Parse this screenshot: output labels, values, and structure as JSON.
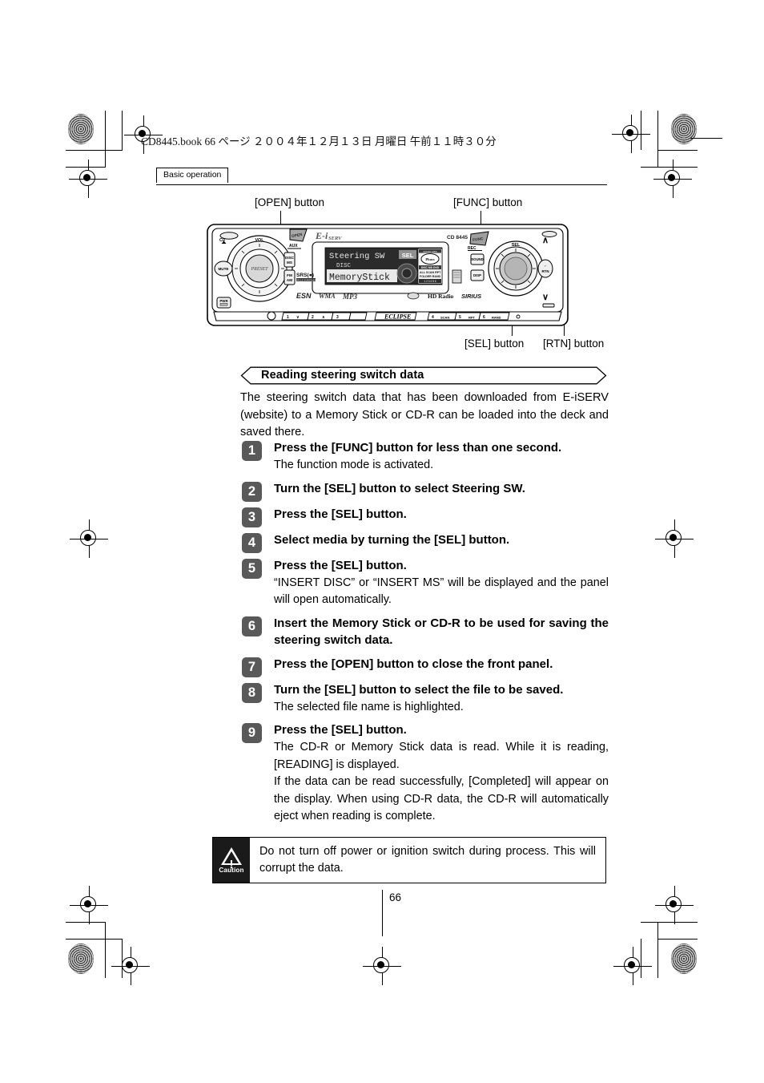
{
  "print_header": {
    "filename_line": "CD8445.book   66 ページ   ２００４年１２月１３日   月曜日   午前１１時３０分"
  },
  "section_tab": {
    "label": "Basic operation"
  },
  "device": {
    "model_label": "CD 8445",
    "brand_main": "E-iSERV",
    "brand_bottom": "ECLIPSE",
    "logo_strip": "ESN WMA MP3",
    "srs_label": "SRS(●)",
    "badges": [
      "HD Radio",
      "SIRIUS"
    ],
    "left_controls": {
      "cd_eject": "CD",
      "aux": "AUX",
      "disc_ms": "DISC MS",
      "fm_am": "FM AM",
      "mute": "MUTE",
      "pwr": "PWR",
      "vol": "VOL",
      "ring": "PRESET"
    },
    "right_controls": {
      "func": "FUNC",
      "rec": "REC",
      "sound": "SOUND",
      "disp": "DISP",
      "sel": "SEL",
      "rtn": "RTN",
      "up": "∧",
      "down": "∨"
    },
    "preset_buttons": [
      "1",
      "2",
      "3",
      "4",
      "5",
      "6"
    ],
    "preset_sublabels": [
      "∨",
      "∧",
      "",
      "SCAN",
      "RPT",
      "RAND"
    ],
    "display": {
      "line1": "Steering SW",
      "line2": "DISC",
      "line3": "MemoryStick",
      "sel_tag": "SEL",
      "indicator_rows": [
        "DISC  MS  DVD",
        "ALL SCAN RPT",
        "FOLDER RAND"
      ]
    }
  },
  "callouts": {
    "open": "[OPEN] button",
    "func": "[FUNC] button",
    "sel": "[SEL] button",
    "rtn": "[RTN] button"
  },
  "section": {
    "heading": "Reading steering switch data",
    "intro": "The steering switch data that has been downloaded from E-iSERV (website) to a Memory Stick or CD-R can be loaded into the deck and saved there."
  },
  "steps": [
    {
      "num": "1",
      "title": "Press the [FUNC] button for less than one second.",
      "note": "The function mode is activated."
    },
    {
      "num": "2",
      "title": "Turn the [SEL] button to select Steering SW.",
      "note": ""
    },
    {
      "num": "3",
      "title": "Press the [SEL] button.",
      "note": ""
    },
    {
      "num": "4",
      "title": "Select media by turning the [SEL] button.",
      "note": ""
    },
    {
      "num": "5",
      "title": "Press the [SEL] button.",
      "note": "“INSERT DISC” or “INSERT MS” will be displayed and the panel will open automatically."
    },
    {
      "num": "6",
      "title": "Insert the Memory Stick or CD-R to be used for saving the steering switch data.",
      "note": ""
    },
    {
      "num": "7",
      "title": "Press the [OPEN] button to close the front panel.",
      "note": ""
    },
    {
      "num": "8",
      "title": "Turn the [SEL] button to select the file to be saved.",
      "note": "The selected file name is highlighted."
    },
    {
      "num": "9",
      "title": "Press the [SEL] button.",
      "note": "The CD-R or Memory Stick data is read. While it is reading, [READING] is displayed.\nIf the data can be read successfully, [Completed] will appear on the display. When using CD-R data, the CD-R will automatically eject when reading is complete."
    }
  ],
  "caution": {
    "label": "Caution",
    "text": "Do not turn off power or ignition switch during process. This will corrupt the data."
  },
  "footer": {
    "page_number": "66"
  },
  "colors": {
    "badge_gray": "#595959",
    "caution_black": "#1a1a1a",
    "display_dark": "#2b2b2b"
  }
}
